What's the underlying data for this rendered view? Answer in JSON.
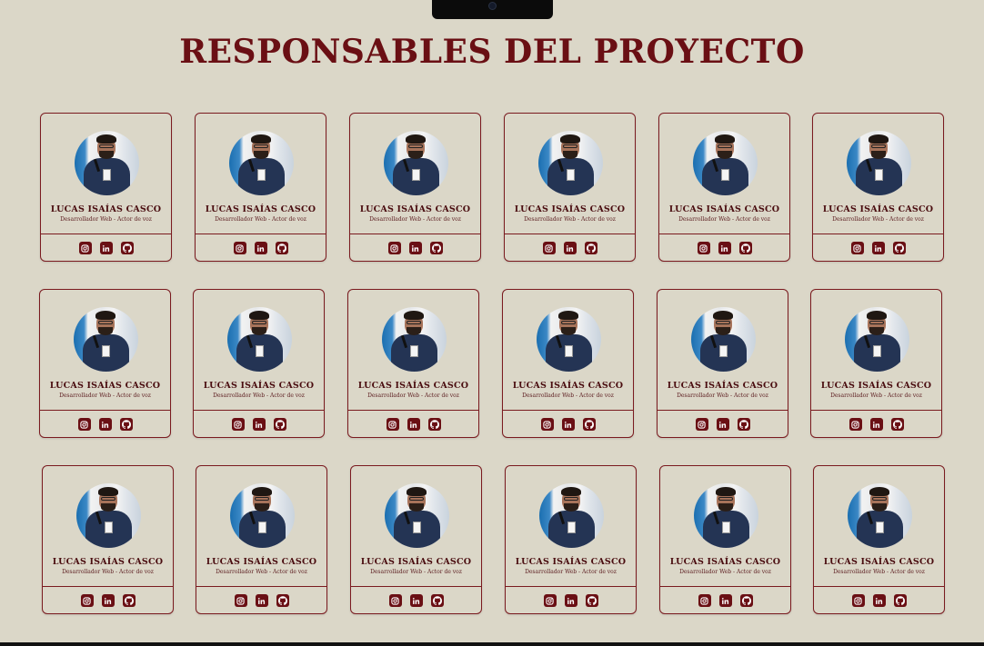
{
  "page": {
    "title": "RESPONSABLES DEL PROYECTO"
  },
  "colors": {
    "background": "#dbd7c8",
    "accent": "#6a0f14",
    "border": "#7a1a1f"
  },
  "cards": [
    {
      "name": "LUCAS ISAÍAS CASCO",
      "role": "Desarrollador Web - Actor de voz",
      "links": [
        "instagram-icon",
        "linkedin-icon",
        "github-icon"
      ]
    },
    {
      "name": "LUCAS ISAÍAS CASCO",
      "role": "Desarrollador Web - Actor de voz",
      "links": [
        "instagram-icon",
        "linkedin-icon",
        "github-icon"
      ]
    },
    {
      "name": "LUCAS ISAÍAS CASCO",
      "role": "Desarrollador Web - Actor de voz",
      "links": [
        "instagram-icon",
        "linkedin-icon",
        "github-icon"
      ]
    },
    {
      "name": "LUCAS ISAÍAS CASCO",
      "role": "Desarrollador Web - Actor de voz",
      "links": [
        "instagram-icon",
        "linkedin-icon",
        "github-icon"
      ]
    },
    {
      "name": "LUCAS ISAÍAS CASCO",
      "role": "Desarrollador Web - Actor de voz",
      "links": [
        "instagram-icon",
        "linkedin-icon",
        "github-icon"
      ]
    },
    {
      "name": "LUCAS ISAÍAS CASCO",
      "role": "Desarrollador Web - Actor de voz",
      "links": [
        "instagram-icon",
        "linkedin-icon",
        "github-icon"
      ]
    },
    {
      "name": "LUCAS ISAÍAS CASCO",
      "role": "Desarrollador Web - Actor de voz",
      "links": [
        "instagram-icon",
        "linkedin-icon",
        "github-icon"
      ]
    },
    {
      "name": "LUCAS ISAÍAS CASCO",
      "role": "Desarrollador Web - Actor de voz",
      "links": [
        "instagram-icon",
        "linkedin-icon",
        "github-icon"
      ]
    },
    {
      "name": "LUCAS ISAÍAS CASCO",
      "role": "Desarrollador Web - Actor de voz",
      "links": [
        "instagram-icon",
        "linkedin-icon",
        "github-icon"
      ]
    },
    {
      "name": "LUCAS ISAÍAS CASCO",
      "role": "Desarrollador Web - Actor de voz",
      "links": [
        "instagram-icon",
        "linkedin-icon",
        "github-icon"
      ]
    },
    {
      "name": "LUCAS ISAÍAS CASCO",
      "role": "Desarrollador Web - Actor de voz",
      "links": [
        "instagram-icon",
        "linkedin-icon",
        "github-icon"
      ]
    },
    {
      "name": "LUCAS ISAÍAS CASCO",
      "role": "Desarrollador Web - Actor de voz",
      "links": [
        "instagram-icon",
        "linkedin-icon",
        "github-icon"
      ]
    },
    {
      "name": "LUCAS ISAÍAS CASCO",
      "role": "Desarrollador Web - Actor de voz",
      "links": [
        "instagram-icon",
        "linkedin-icon",
        "github-icon"
      ]
    },
    {
      "name": "LUCAS ISAÍAS CASCO",
      "role": "Desarrollador Web - Actor de voz",
      "links": [
        "instagram-icon",
        "linkedin-icon",
        "github-icon"
      ]
    },
    {
      "name": "LUCAS ISAÍAS CASCO",
      "role": "Desarrollador Web - Actor de voz",
      "links": [
        "instagram-icon",
        "linkedin-icon",
        "github-icon"
      ]
    },
    {
      "name": "LUCAS ISAÍAS CASCO",
      "role": "Desarrollador Web - Actor de voz",
      "links": [
        "instagram-icon",
        "linkedin-icon",
        "github-icon"
      ]
    },
    {
      "name": "LUCAS ISAÍAS CASCO",
      "role": "Desarrollador Web - Actor de voz",
      "links": [
        "instagram-icon",
        "linkedin-icon",
        "github-icon"
      ]
    },
    {
      "name": "LUCAS ISAÍAS CASCO",
      "role": "Desarrollador Web - Actor de voz",
      "links": [
        "instagram-icon",
        "linkedin-icon",
        "github-icon"
      ]
    }
  ]
}
